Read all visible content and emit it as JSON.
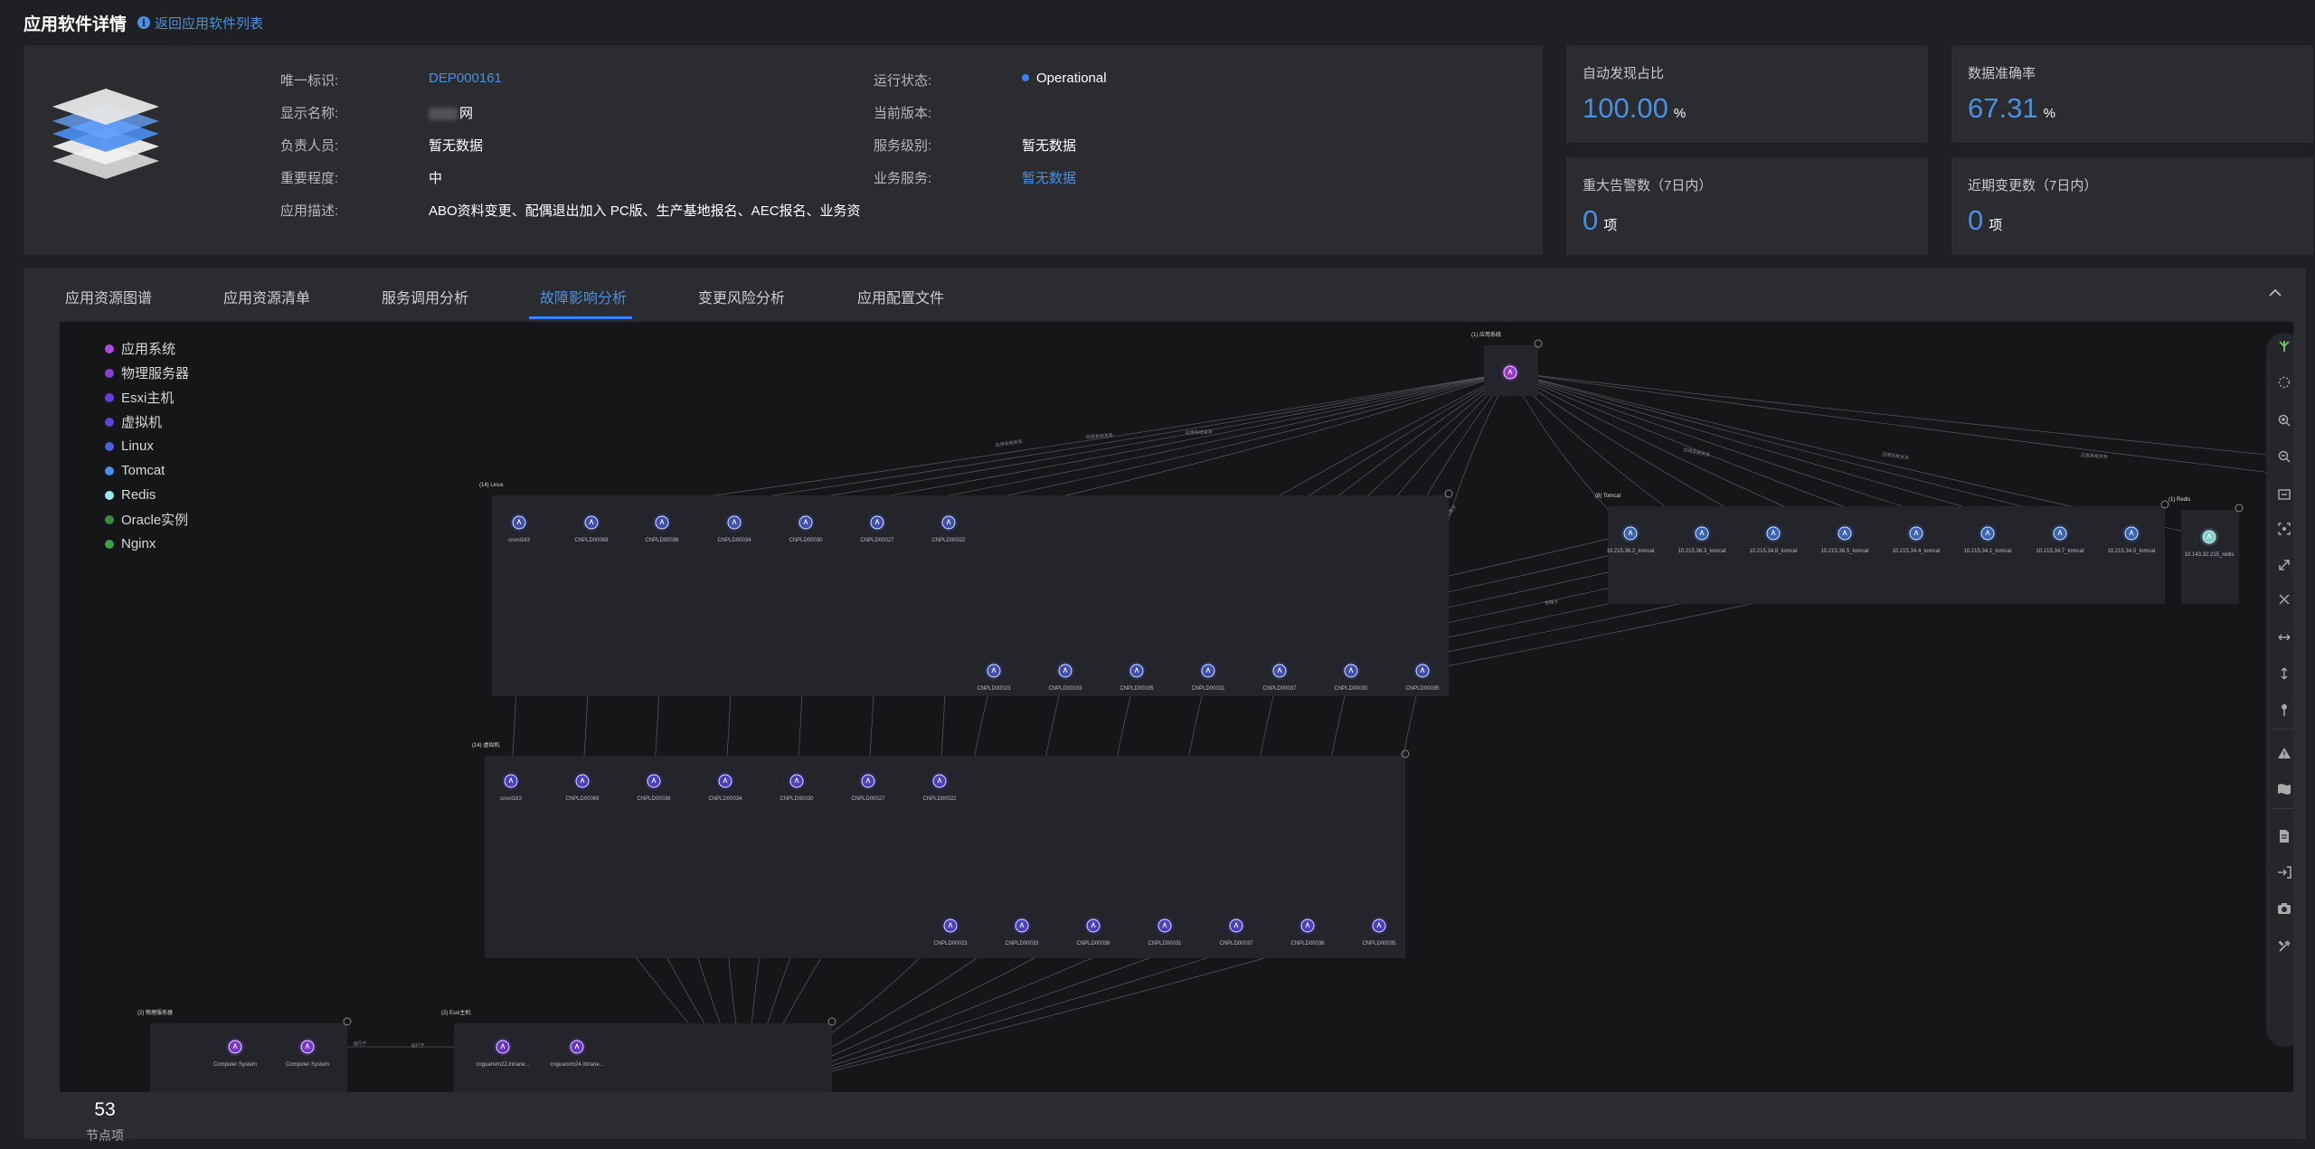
{
  "page": {
    "title": "应用软件详情",
    "back_link": "返回应用软件列表"
  },
  "info": {
    "left": [
      {
        "label": "唯一标识:",
        "value": "DEP000161",
        "link": true
      },
      {
        "label": "显示名称:",
        "value": "网",
        "blurred": true
      },
      {
        "label": "负责人员:",
        "value": "暂无数据"
      },
      {
        "label": "重要程度:",
        "value": "中"
      },
      {
        "label": "应用描述:",
        "value": "ABO资料变更、配偶退出加入 PC版、生产基地报名、AEC报名、业务资"
      }
    ],
    "right": [
      {
        "label": "运行状态:",
        "value": "Operational",
        "status": true
      },
      {
        "label": "当前版本:",
        "value": ""
      },
      {
        "label": "服务级别:",
        "value": "暂无数据"
      },
      {
        "label": "业务服务:",
        "value": "暂无数据",
        "link": true
      }
    ]
  },
  "stats": [
    {
      "title": "自动发现占比",
      "value": "100.00",
      "unit": "%"
    },
    {
      "title": "数据准确率",
      "value": "67.31",
      "unit": "%"
    },
    {
      "title": "重大告警数（7日内）",
      "value": "0",
      "unit": "项"
    },
    {
      "title": "近期变更数（7日内）",
      "value": "0",
      "unit": "项"
    }
  ],
  "tabs": [
    {
      "label": "应用资源图谱"
    },
    {
      "label": "应用资源清单"
    },
    {
      "label": "服务调用分析"
    },
    {
      "label": "故障影响分析",
      "active": true
    },
    {
      "label": "变更风险分析"
    },
    {
      "label": "应用配置文件"
    }
  ],
  "legend": [
    {
      "label": "应用系统",
      "color": "#b04ad8"
    },
    {
      "label": "物理服务器",
      "color": "#8a3fd1"
    },
    {
      "label": "Esxi主机",
      "color": "#6a3de0"
    },
    {
      "label": "虚拟机",
      "color": "#5b45d6"
    },
    {
      "label": "Linux",
      "color": "#4a63d8"
    },
    {
      "label": "Tomcat",
      "color": "#4a8fe8"
    },
    {
      "label": "Redis",
      "color": "#9fe6f0"
    },
    {
      "label": "Oracle实例",
      "color": "#3c8a3c"
    },
    {
      "label": "Nginx",
      "color": "#3fa04a"
    }
  ],
  "graph": {
    "app_group": {
      "label": "(1) 应用系统"
    },
    "linux_group": {
      "label": "(14) Linux",
      "top": [
        "cnvsl163",
        "CNPLD00069",
        "CNPLD00036",
        "CNPLD00034",
        "CNPLD00030",
        "CNPLD00027",
        "CNPLD00022"
      ],
      "bottom": [
        "CNPLD00023",
        "CNPLD00033",
        "CNPLD00035",
        "CNPLD00031",
        "CNPLD00037",
        "CNPLD00030",
        "CNPLD00035"
      ]
    },
    "tomcat_group": {
      "label": "(8) Tomcat",
      "nodes": [
        "10.215.36.2_tomcat",
        "10.215.36.3_tomcat",
        "10.215.34.8_tomcat",
        "10.215.36.5_tomcat",
        "10.215.34.4_tomcat",
        "10.215.34.1_tomcat",
        "10.215.34.7_tomcat",
        "10.215.34.5_tomcat"
      ]
    },
    "redis_group": {
      "label": "(1) Redis",
      "nodes": [
        "10.143.32.215_redis"
      ]
    },
    "vm_group": {
      "label": "(14) 虚拟机",
      "top": [
        "cnvsl163",
        "CNPLD00069",
        "CNPLD00036",
        "CNPLD00034",
        "CNPLD00030",
        "CNPLD00027",
        "CNPLD00022"
      ],
      "bottom": [
        "CNPLD00023",
        "CNPLD00033",
        "CNPLD00036",
        "CNPLD00031",
        "CNPLD00037",
        "CNPLD00036",
        "CNPLD00035"
      ]
    },
    "physical_group": {
      "label": "(2) 物理服务器",
      "nodes": [
        "Computer System",
        "Computer System"
      ]
    },
    "esxi_group": {
      "label": "(2) Esxi主机",
      "nodes": [
        "cnguanvm22.intrane...",
        "cnguanvm24.intrane..."
      ]
    },
    "edge_labels": [
      "应用系统关系",
      "依赖于",
      "运行于"
    ]
  },
  "toolbar_icons": [
    "branch-icon",
    "lasso-icon",
    "zoom-in-icon",
    "zoom-out-icon",
    "fit-view-icon",
    "real-size-icon",
    "expand-icon",
    "shrink-icon",
    "horizontal-icon",
    "vertical-icon",
    "pin-icon",
    "alert-icon",
    "map-icon",
    "document-icon",
    "import-icon",
    "camera-icon",
    "tools-icon"
  ],
  "footer": {
    "count": "53",
    "caption": "节点项"
  }
}
